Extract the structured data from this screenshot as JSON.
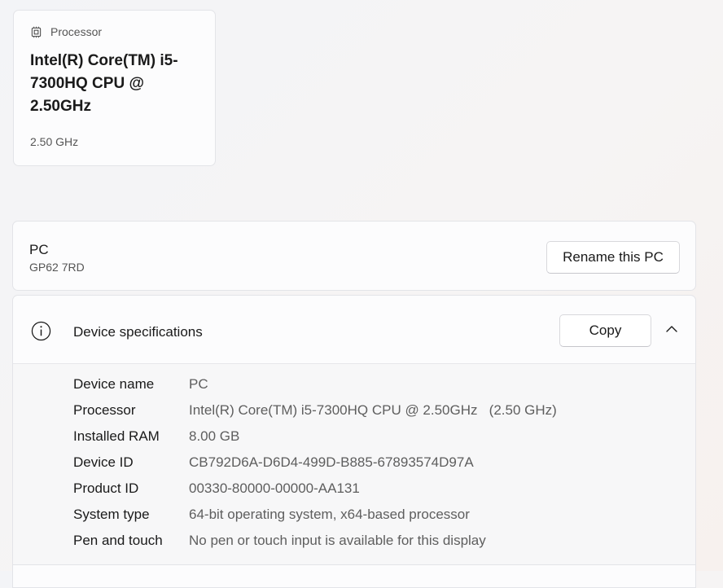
{
  "processor_card": {
    "heading": "Processor",
    "name": "Intel(R) Core(TM) i5-7300HQ CPU @ 2.50GHz",
    "speed": "2.50 GHz"
  },
  "pc_card": {
    "name": "PC",
    "model": "GP62 7RD",
    "rename_label": "Rename this PC"
  },
  "specs": {
    "title": "Device specifications",
    "copy_label": "Copy",
    "rows": [
      {
        "label": "Device name",
        "value": "PC"
      },
      {
        "label": "Processor",
        "value": "Intel(R) Core(TM) i5-7300HQ CPU @ 2.50GHz   (2.50 GHz)"
      },
      {
        "label": "Installed RAM",
        "value": "8.00 GB"
      },
      {
        "label": "Device ID",
        "value": "CB792D6A-D6D4-499D-B885-67893574D97A"
      },
      {
        "label": "Product ID",
        "value": "00330-80000-00000-AA131"
      },
      {
        "label": "System type",
        "value": "64-bit operating system, x64-based processor"
      },
      {
        "label": "Pen and touch",
        "value": "No pen or touch input is available for this display"
      }
    ]
  },
  "icons": {
    "processor": "chip-icon",
    "specs": "info-icon",
    "collapse": "chevron-up-icon"
  }
}
